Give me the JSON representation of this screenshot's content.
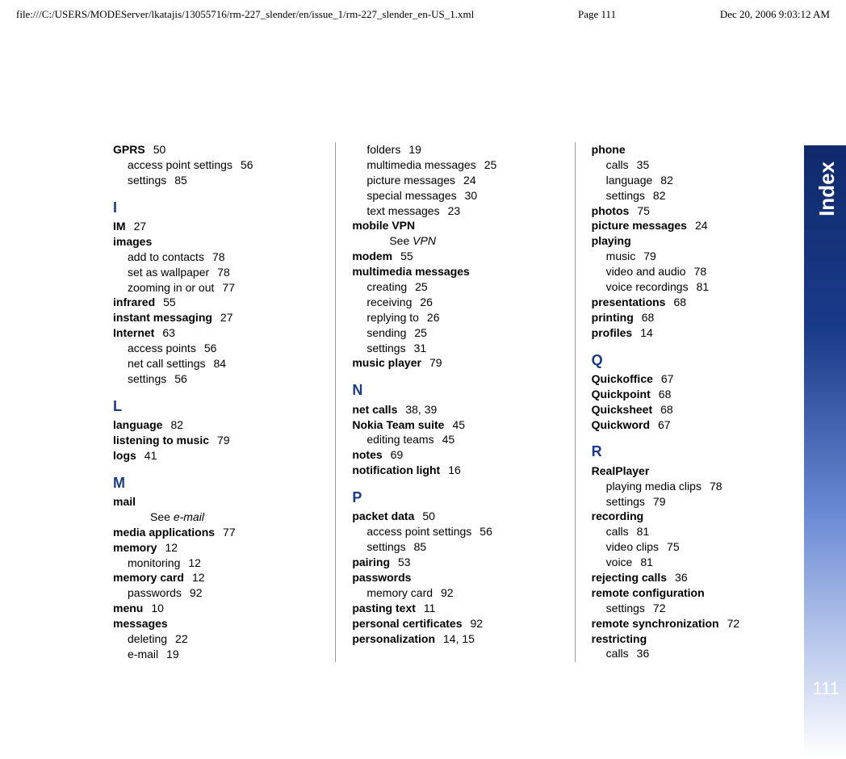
{
  "header": {
    "path": "file:///C:/USERS/MODEServer/lkatajis/13055716/rm-227_slender/en/issue_1/rm-227_slender_en-US_1.xml",
    "page": "Page 111",
    "datetime": "Dec 20, 2006 9:03:12 AM"
  },
  "side": {
    "label": "Index",
    "page": "111"
  },
  "col1": {
    "gprs": "GPRS",
    "gprs_p": "50",
    "gprs_s1": "access point settings",
    "gprs_s1p": "56",
    "gprs_s2": "settings",
    "gprs_s2p": "85",
    "letI": "I",
    "im": "IM",
    "im_p": "27",
    "images": "images",
    "images_s1": "add to contacts",
    "images_s1p": "78",
    "images_s2": "set as wallpaper",
    "images_s2p": "78",
    "images_s3": "zooming in or out",
    "images_s3p": "77",
    "infrared": "infrared",
    "infrared_p": "55",
    "instmsg": "instant messaging",
    "instmsg_p": "27",
    "internet": "Internet",
    "internet_p": "63",
    "internet_s1": "access points",
    "internet_s1p": "56",
    "internet_s2": "net call settings",
    "internet_s2p": "84",
    "internet_s3": "settings",
    "internet_s3p": "56",
    "letL": "L",
    "language": "language",
    "language_p": "82",
    "listen": "listening to music",
    "listen_p": "79",
    "logs": "logs",
    "logs_p": "41",
    "letM": "M",
    "mail": "mail",
    "mail_see": "See ",
    "mail_see_i": "e-mail",
    "mediaapp": "media applications",
    "mediaapp_p": "77",
    "memory": "memory",
    "memory_p": "12",
    "memory_s1": "monitoring",
    "memory_s1p": "12",
    "memcard": "memory card",
    "memcard_p": "12",
    "memcard_s1": "passwords",
    "memcard_s1p": "92",
    "menu": "menu",
    "menu_p": "10",
    "messages": "messages",
    "messages_s1": "deleting",
    "messages_s1p": "22",
    "messages_s2": "e-mail",
    "messages_s2p": "19"
  },
  "col2": {
    "s1": "folders",
    "s1p": "19",
    "s2": "multimedia messages",
    "s2p": "25",
    "s3": "picture messages",
    "s3p": "24",
    "s4": "special messages",
    "s4p": "30",
    "s5": "text messages",
    "s5p": "23",
    "mvpn": "mobile VPN",
    "mvpn_see": "See ",
    "mvpn_see_i": "VPN",
    "modem": "modem",
    "modem_p": "55",
    "mms": "multimedia messages",
    "mms_s1": "creating",
    "mms_s1p": "25",
    "mms_s2": "receiving",
    "mms_s2p": "26",
    "mms_s3": "replying to",
    "mms_s3p": "26",
    "mms_s4": "sending",
    "mms_s4p": "25",
    "mms_s5": "settings",
    "mms_s5p": "31",
    "music": "music player",
    "music_p": "79",
    "letN": "N",
    "netcalls": "net calls",
    "netcalls_p": "38, 39",
    "nokia": "Nokia Team suite",
    "nokia_p": "45",
    "nokia_s1": "editing teams",
    "nokia_s1p": "45",
    "notes": "notes",
    "notes_p": "69",
    "notif": "notification light",
    "notif_p": "16",
    "letP": "P",
    "packet": "packet data",
    "packet_p": "50",
    "packet_s1": "access point settings",
    "packet_s1p": "56",
    "packet_s2": "settings",
    "packet_s2p": "85",
    "pairing": "pairing",
    "pairing_p": "53",
    "pass": "passwords",
    "pass_s1": "memory card",
    "pass_s1p": "92",
    "paste": "pasting text",
    "paste_p": "11",
    "pcert": "personal certificates",
    "pcert_p": "92",
    "personal": "personalization",
    "personal_p": "14, 15"
  },
  "col3": {
    "phone": "phone",
    "phone_s1": "calls",
    "phone_s1p": "35",
    "phone_s2": "language",
    "phone_s2p": "82",
    "phone_s3": "settings",
    "phone_s3p": "82",
    "photos": "photos",
    "photos_p": "75",
    "picmsg": "picture messages",
    "picmsg_p": "24",
    "playing": "playing",
    "playing_s1": "music",
    "playing_s1p": "79",
    "playing_s2": "video and audio",
    "playing_s2p": "78",
    "playing_s3": "voice recordings",
    "playing_s3p": "81",
    "present": "presentations",
    "present_p": "68",
    "print": "printing",
    "print_p": "68",
    "profiles": "profiles",
    "profiles_p": "14",
    "letQ": "Q",
    "qoffice": "Quickoffice",
    "qoffice_p": "67",
    "qpoint": "Quickpoint",
    "qpoint_p": "68",
    "qsheet": "Quicksheet",
    "qsheet_p": "68",
    "qword": "Quickword",
    "qword_p": "67",
    "letR": "R",
    "real": "RealPlayer",
    "real_s1": "playing media clips",
    "real_s1p": "78",
    "real_s2": "settings",
    "real_s2p": "79",
    "rec": "recording",
    "rec_s1": "calls",
    "rec_s1p": "81",
    "rec_s2": "video clips",
    "rec_s2p": "75",
    "rec_s3": "voice",
    "rec_s3p": "81",
    "reject": "rejecting calls",
    "reject_p": "36",
    "remcfg": "remote configuration",
    "remcfg_s1": "settings",
    "remcfg_s1p": "72",
    "remsync": "remote synchronization",
    "remsync_p": "72",
    "restrict": "restricting",
    "restrict_s1": "calls",
    "restrict_s1p": "36"
  }
}
